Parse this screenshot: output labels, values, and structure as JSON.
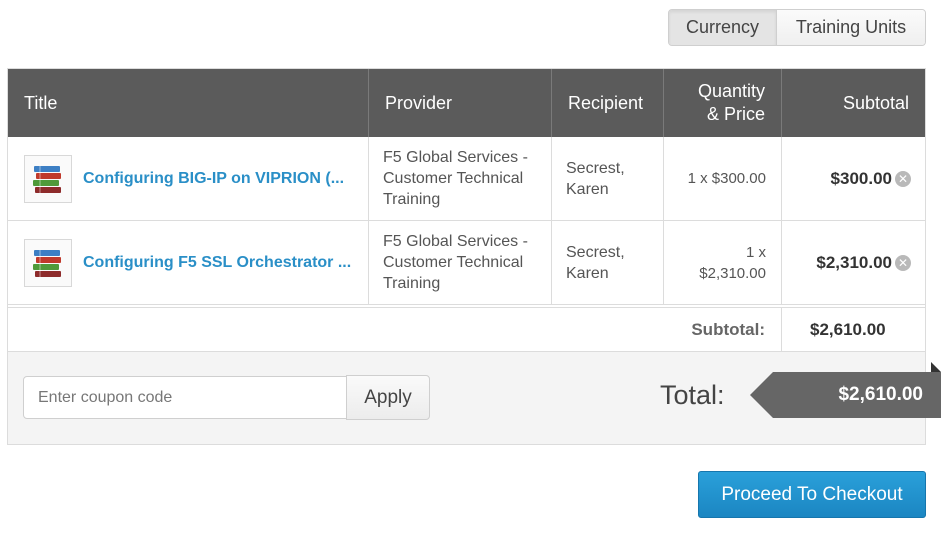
{
  "toggle": {
    "currency": "Currency",
    "training_units": "Training Units",
    "selected": "Currency"
  },
  "table": {
    "headers": {
      "title": "Title",
      "provider": "Provider",
      "recipient": "Recipient",
      "qty_line1": "Quantity",
      "qty_line2": "& Price",
      "subtotal": "Subtotal"
    },
    "items": [
      {
        "title": "Configuring BIG-IP on VIPRION (...",
        "provider": "F5 Global Services - Customer Technical Training",
        "recipient": "Secrest, Karen",
        "qty_price_line1": "1 x $300.00",
        "qty_price_line2": "",
        "subtotal": "$300.00",
        "icon": "book-stack-icon"
      },
      {
        "title": "Configuring F5 SSL Orchestrator ...",
        "provider": "F5 Global Services - Customer Technical Training",
        "recipient": "Secrest, Karen",
        "qty_price_line1": "1 x",
        "qty_price_line2": "$2,310.00",
        "subtotal": "$2,310.00",
        "icon": "book-stack-icon"
      }
    ],
    "subtotal_label": "Subtotal:",
    "subtotal_value": "$2,610.00"
  },
  "coupon": {
    "placeholder": "Enter coupon code",
    "value": "",
    "apply_label": "Apply"
  },
  "total": {
    "label": "Total:",
    "value": "$2,610.00"
  },
  "checkout_label": "Proceed To Checkout",
  "colors": {
    "header_bg": "#5b5b5b",
    "link": "#2a8fc7",
    "primary_button": "#1b86c2",
    "total_badge": "#666666"
  }
}
